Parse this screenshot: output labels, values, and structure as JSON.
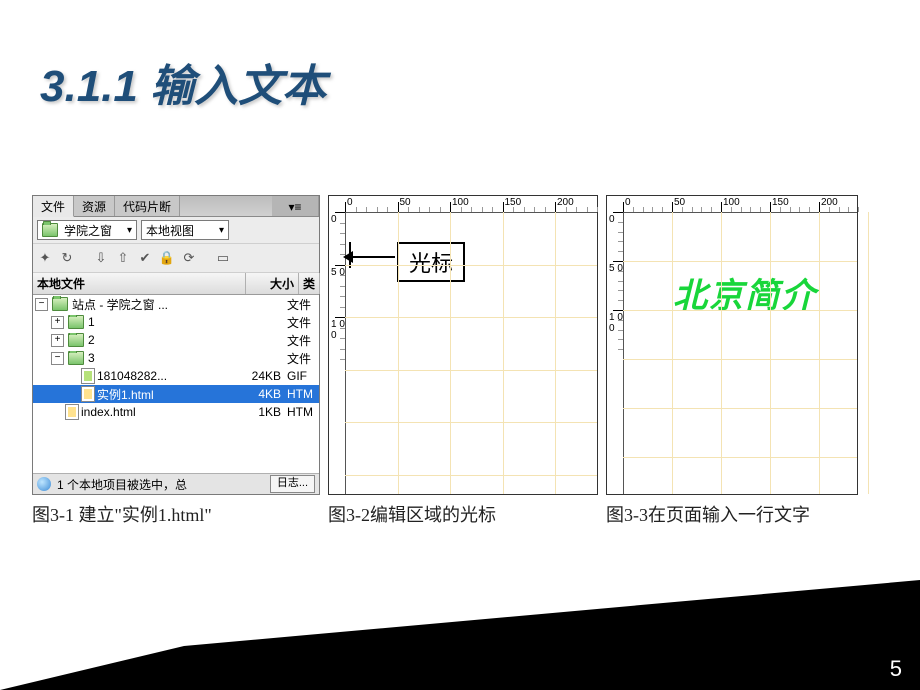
{
  "title": "3.1.1 输入文本",
  "page_number": "5",
  "fig1": {
    "caption": "图3-1 建立\"实例1.html\"",
    "tabs": {
      "t0": "文件",
      "t1": "资源",
      "t2": "代码片断"
    },
    "site_dd": "学院之窗",
    "view_dd": "本地视图",
    "headers": {
      "name": "本地文件",
      "size": "大小",
      "type": "类"
    },
    "rows": [
      {
        "name": "站点 - 学院之窗  ...",
        "size": "",
        "type": "文件",
        "icon": "folder",
        "depth": 0,
        "tw": "−"
      },
      {
        "name": "1",
        "size": "",
        "type": "文件",
        "icon": "folder",
        "depth": 1,
        "tw": "+"
      },
      {
        "name": "2",
        "size": "",
        "type": "文件",
        "icon": "folder",
        "depth": 1,
        "tw": "+"
      },
      {
        "name": "3",
        "size": "",
        "type": "文件",
        "icon": "folder",
        "depth": 1,
        "tw": "−"
      },
      {
        "name": "181048282...",
        "size": "24KB",
        "type": "GIF",
        "icon": "gif",
        "depth": 2,
        "tw": ""
      },
      {
        "name": "实例1.html",
        "size": "4KB",
        "type": "HTM",
        "icon": "html",
        "depth": 2,
        "tw": "",
        "selected": true
      },
      {
        "name": "index.html",
        "size": "1KB",
        "type": "HTM",
        "icon": "html",
        "depth": 1,
        "tw": ""
      }
    ],
    "status": "1 个本地项目被选中，总",
    "log_btn": "日志..."
  },
  "fig2": {
    "caption": "图3-2编辑区域的光标",
    "cursor_label": "光标",
    "h_ticks": [
      "0",
      "50",
      "100",
      "150",
      "200"
    ],
    "v_ticks": [
      "0",
      "5 0",
      "1 0 0"
    ]
  },
  "fig3": {
    "caption": "图3-3在页面输入一行文字",
    "text": "北京简介",
    "h_ticks": [
      "0",
      "50",
      "100",
      "150",
      "200"
    ],
    "v_ticks": [
      "0",
      "5 0",
      "1 0 0"
    ]
  }
}
